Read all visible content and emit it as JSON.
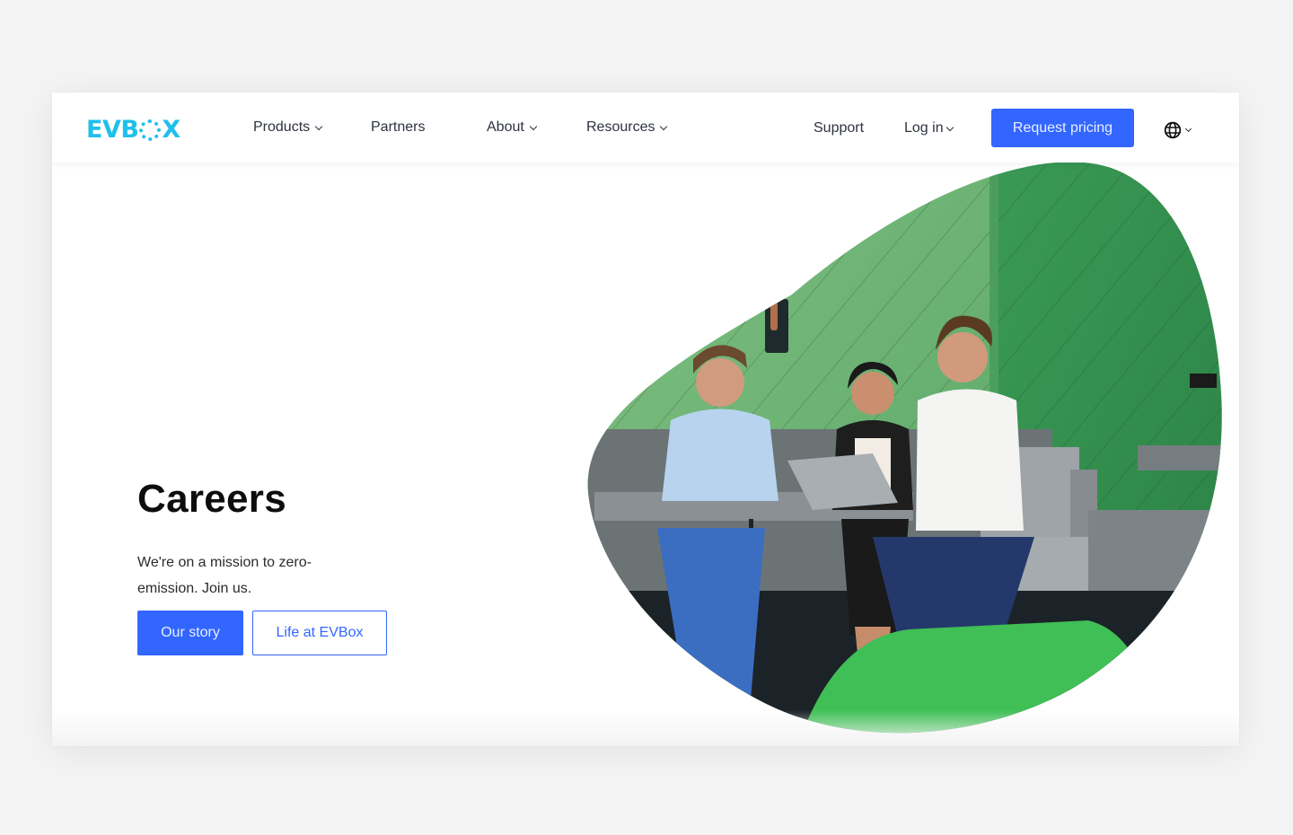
{
  "brand": {
    "logo_text_left": "EVB",
    "logo_text_right": "X",
    "accent_color": "#1fc0ea",
    "primary_color": "#3366ff"
  },
  "nav": {
    "items": [
      {
        "label": "Products",
        "has_dropdown": true
      },
      {
        "label": "Partners",
        "has_dropdown": false
      },
      {
        "label": "About",
        "has_dropdown": true
      },
      {
        "label": "Resources",
        "has_dropdown": true
      }
    ],
    "support_label": "Support",
    "login_label": "Log in",
    "cta_label": "Request pricing",
    "language_icon": "globe-icon"
  },
  "hero": {
    "title": "Careers",
    "subtitle": "We're on a mission to zero-emission. Join us.",
    "primary_button": "Our story",
    "secondary_button": "Life at EVBox",
    "image_alt": "Three colleagues laughing around a laptop in a green office booth"
  }
}
